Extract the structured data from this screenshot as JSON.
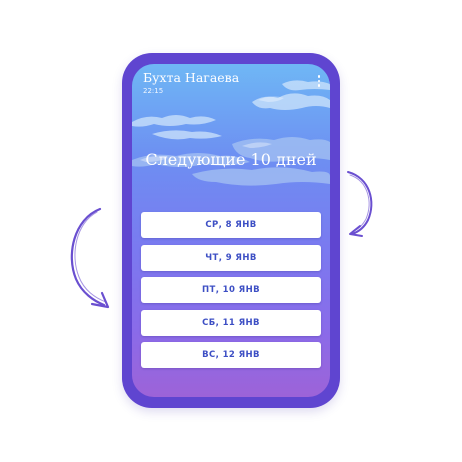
{
  "header": {
    "title": "Бухта Нагаева",
    "time": "22:15",
    "menu_icon": "more-vertical-icon"
  },
  "headline": "Следующие 10 дней",
  "days": [
    {
      "label": "СР, 8 ЯНВ"
    },
    {
      "label": "ЧТ, 9 ЯНВ"
    },
    {
      "label": "ПТ, 10 ЯНВ"
    },
    {
      "label": "СБ, 11 ЯНВ"
    },
    {
      "label": "ВС, 12 ЯНВ"
    }
  ],
  "colors": {
    "phone_frame": "#5f45d0",
    "sky_top": "#6fb7f5",
    "sky_bottom": "#9d63d8",
    "day_text": "#3d4fc4",
    "arrow": "#6a4fd0"
  }
}
